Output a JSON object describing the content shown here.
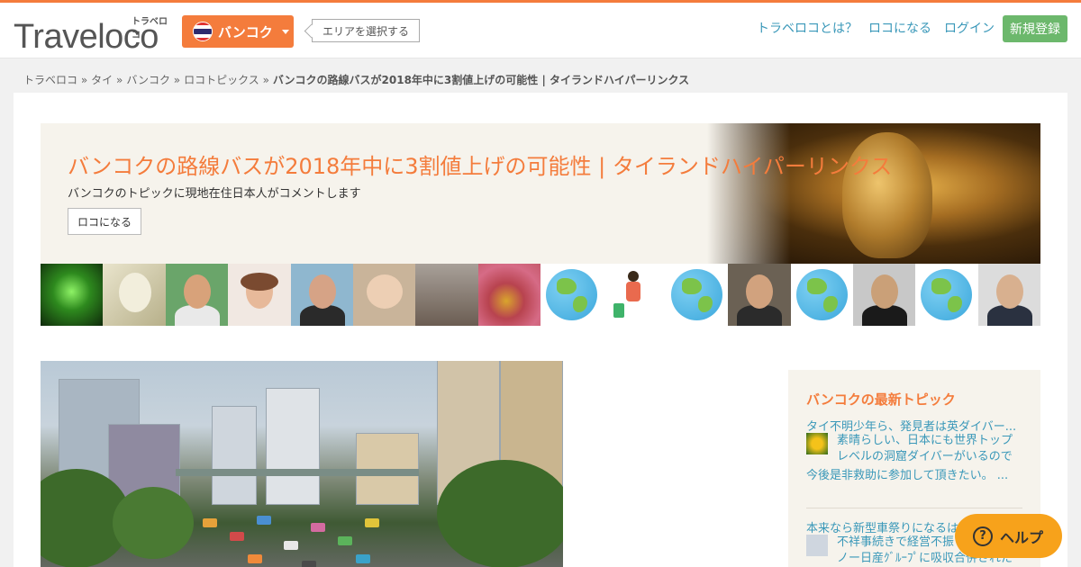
{
  "header": {
    "logo": "Traveloco",
    "logo_kana": "トラベロコ",
    "city_button": "バンコク",
    "area_button": "エリアを選択する",
    "nav": [
      "トラベロコとは？",
      "ロコになる",
      "ログイン"
    ],
    "signup": "新規登録"
  },
  "breadcrumb": [
    "トラベロコ »",
    "タイ »",
    "バンコク »",
    "ロコトピックス »",
    "バンコクの路線バスが2018年中に3割値上げの可能性 | タイランドハイパーリンクス"
  ],
  "hero": {
    "title": "バンコクの路線バスが2018年中に3割値上げの可能性 | タイランドハイパーリンクス",
    "subtitle": "バンコクのトピックに現地在住日本人がコメントします",
    "button": "ロコになる"
  },
  "sidebar": {
    "title": "バンコクの最新トピック",
    "topics": [
      {
        "link": "タイ不明少年ら、発見者は英ダイバー...",
        "comment_first": "素晴らしい、日本にも世界トップ",
        "comment_rest": "レベルの洞窟ダイバーがいるので",
        "comment_tail": "今後是非救助に参加して頂きたい。 ..."
      },
      {
        "link": "本来なら新型車祭りになるは",
        "comment_first": "不祥事続きで経営不振",
        "comment_rest": "ノー日産ｸﾞﾙｰﾌﾟに吸収合併された"
      }
    ]
  },
  "help": {
    "label": "ヘルプ",
    "icon": "?"
  },
  "colors": {
    "accent": "#f47c3c",
    "link": "#3a98b9",
    "signup": "#6cb86c",
    "help": "#f7a21b"
  }
}
